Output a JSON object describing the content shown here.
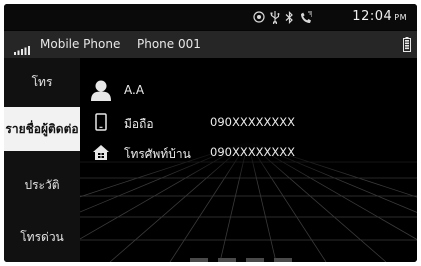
{
  "status": {
    "time": "12:04",
    "ampm": "PM",
    "icons": [
      "navigation-icon",
      "usb-icon",
      "bluetooth-icon",
      "phone-signal-icon"
    ]
  },
  "header": {
    "device": "Mobile Phone",
    "phone": "Phone 001"
  },
  "sidebar": {
    "items": [
      {
        "label": "โทร",
        "active": false
      },
      {
        "label": "รายชื่อผู้ติดต่อ",
        "active": true
      },
      {
        "label": "ประวัติ",
        "active": false
      },
      {
        "label": "โทรด่วน",
        "active": false
      }
    ]
  },
  "contact": {
    "name": "A.A",
    "entries": [
      {
        "icon": "mobile-phone-icon",
        "label": "มือถือ",
        "number": "090XXXXXXXX"
      },
      {
        "icon": "home-icon",
        "label": "โทรศัพท์บ้าน",
        "number": "090XXXXXXXX"
      }
    ]
  },
  "colors": {
    "background": "#050505",
    "header": "#262626",
    "active_tab": "#f2f2f2",
    "text": "#ededed"
  }
}
